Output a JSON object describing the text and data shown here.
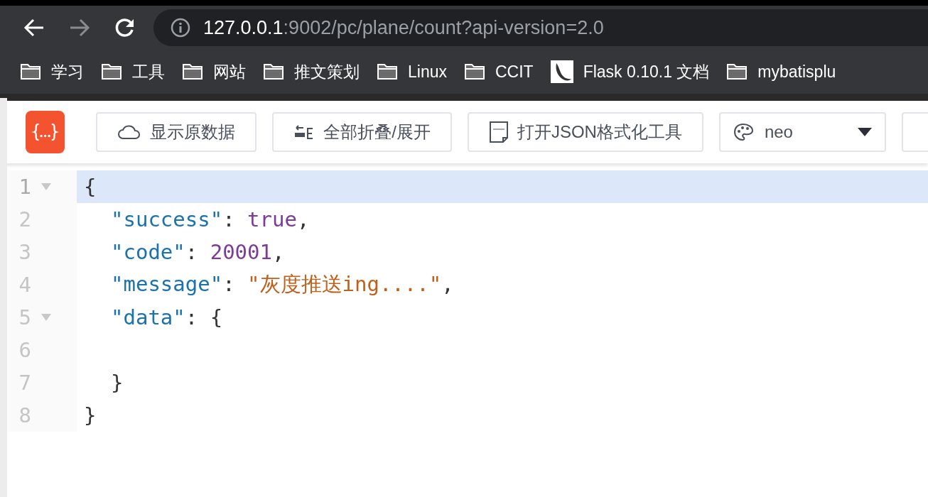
{
  "browser": {
    "url_host": "127.0.0.1",
    "url_rest": ":9002/pc/plane/count?api-version=2.0",
    "bookmarks": [
      {
        "kind": "folder",
        "label": "学习"
      },
      {
        "kind": "folder",
        "label": "工具"
      },
      {
        "kind": "folder",
        "label": "网站"
      },
      {
        "kind": "folder",
        "label": "推文策划"
      },
      {
        "kind": "folder",
        "label": "Linux"
      },
      {
        "kind": "folder",
        "label": "CCIT"
      },
      {
        "kind": "site",
        "label": "Flask 0.10.1 文档"
      },
      {
        "kind": "folder",
        "label": "mybatisplu"
      }
    ]
  },
  "toolbar": {
    "buttons": [
      {
        "kind": "cloud",
        "label": "显示原数据"
      },
      {
        "kind": "fold",
        "label": "全部折叠/展开"
      },
      {
        "kind": "json",
        "label": "打开JSON格式化工具"
      }
    ],
    "theme": {
      "value": "neo"
    }
  },
  "editor": {
    "lines": [
      {
        "number": "1",
        "foldable": true,
        "selected": true,
        "tokens": [
          {
            "kind": "punct",
            "text": "{"
          }
        ],
        "children": [
          {
            "number": "2",
            "foldable": false,
            "selected": false,
            "tokens": [
              {
                "kind": "key",
                "text": "\"success\""
              },
              {
                "kind": "punct",
                "text": ": "
              },
              {
                "kind": "literal",
                "text": "true"
              },
              {
                "kind": "punct",
                "text": ","
              }
            ]
          },
          {
            "number": "3",
            "foldable": false,
            "selected": false,
            "tokens": [
              {
                "kind": "key",
                "text": "\"code\""
              },
              {
                "kind": "punct",
                "text": ": "
              },
              {
                "kind": "literal",
                "text": "20001"
              },
              {
                "kind": "punct",
                "text": ","
              }
            ]
          },
          {
            "number": "4",
            "foldable": false,
            "selected": false,
            "tokens": [
              {
                "kind": "key",
                "text": "\"message\""
              },
              {
                "kind": "punct",
                "text": ": "
              },
              {
                "kind": "string",
                "text": "\"灰度推送ing....\""
              },
              {
                "kind": "punct",
                "text": ","
              }
            ]
          },
          {
            "number": "5",
            "foldable": true,
            "selected": false,
            "tokens": [
              {
                "kind": "key",
                "text": "\"data\""
              },
              {
                "kind": "punct",
                "text": ": {"
              }
            ],
            "children": [
              {
                "number": "6",
                "foldable": false,
                "selected": false
              }
            ]
          },
          {
            "number": "7",
            "foldable": false,
            "selected": false,
            "tokens": [
              {
                "kind": "punct",
                "text": "}"
              }
            ]
          }
        ]
      },
      {
        "number": "8",
        "foldable": false,
        "selected": false,
        "tokens": [
          {
            "kind": "punct",
            "text": "}"
          }
        ]
      }
    ]
  }
}
